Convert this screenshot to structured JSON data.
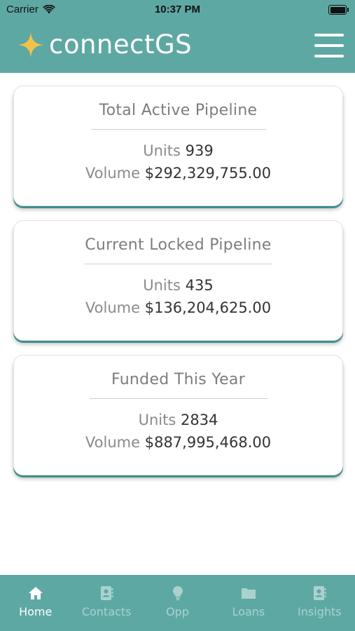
{
  "status_bar": {
    "carrier": "Carrier",
    "time": "10:37 PM"
  },
  "header": {
    "brand": "connectGS"
  },
  "cards": [
    {
      "title": "Total Active Pipeline",
      "units_label": "Units",
      "units": "939",
      "volume_label": "Volume",
      "volume": "$292,329,755.00"
    },
    {
      "title": "Current Locked Pipeline",
      "units_label": "Units",
      "units": "435",
      "volume_label": "Volume",
      "volume": "$136,204,625.00"
    },
    {
      "title": "Funded This Year",
      "units_label": "Units",
      "units": "2834",
      "volume_label": "Volume",
      "volume": "$887,995,468.00"
    }
  ],
  "tabs": [
    {
      "label": "Home",
      "icon": "home-icon",
      "active": true
    },
    {
      "label": "Contacts",
      "icon": "contacts-icon",
      "active": false
    },
    {
      "label": "Opp",
      "icon": "lightbulb-icon",
      "active": false
    },
    {
      "label": "Loans",
      "icon": "folder-icon",
      "active": false
    },
    {
      "label": "Insights",
      "icon": "insights-icon",
      "active": false
    }
  ],
  "colors": {
    "brand": "#5ea8a4",
    "accent_star": "#f3c04a",
    "card_underline": "#3f8f8c"
  }
}
